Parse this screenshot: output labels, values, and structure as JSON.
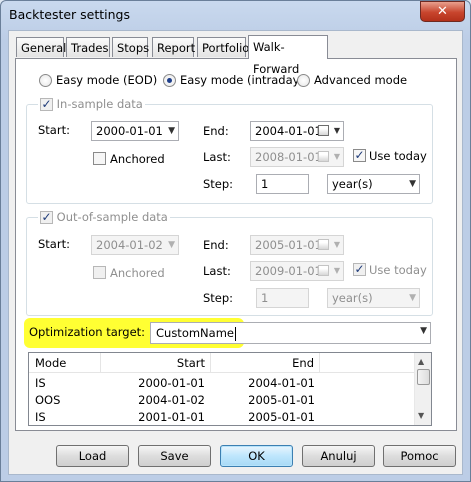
{
  "window": {
    "title": "Backtester settings",
    "close_glyph": "✕"
  },
  "tabs": [
    "General",
    "Trades",
    "Stops",
    "Report",
    "Portfolio",
    "Walk-Forward"
  ],
  "active_tab": "Walk-Forward",
  "modes": [
    {
      "label": "Easy mode (EOD)",
      "selected": false
    },
    {
      "label": "Easy mode (intraday)",
      "selected": true
    },
    {
      "label": "Advanced mode",
      "selected": false
    }
  ],
  "in_sample": {
    "title": "In-sample data",
    "start_label": "Start:",
    "start_value": "2000-01-01",
    "anchored_label": "Anchored",
    "end_label": "End:",
    "end_value": "2004-01-01",
    "last_label": "Last:",
    "last_value": "2008-01-01",
    "use_today_label": "Use today",
    "step_label": "Step:",
    "step_value": "1",
    "step_unit": "year(s)"
  },
  "out_sample": {
    "title": "Out-of-sample data",
    "start_label": "Start:",
    "start_value": "2004-01-02",
    "anchored_label": "Anchored",
    "end_label": "End:",
    "end_value": "2005-01-01",
    "last_label": "Last:",
    "last_value": "2009-01-01",
    "use_today_label": "Use today",
    "step_label": "Step:",
    "step_value": "1",
    "step_unit": "year(s)"
  },
  "optimization": {
    "label": "Optimization target:",
    "value": "CustomName"
  },
  "table": {
    "columns": [
      "Mode",
      "Start",
      "End"
    ],
    "rows": [
      [
        "IS",
        "2000-01-01",
        "2004-01-01"
      ],
      [
        "OOS",
        "2004-01-02",
        "2005-01-01"
      ],
      [
        "IS",
        "2001-01-01",
        "2005-01-01"
      ]
    ]
  },
  "buttons": [
    "Load",
    "Save",
    "OK",
    "Anuluj",
    "Pomoc"
  ],
  "colors": {
    "highlight": "#ffff33",
    "default_button": "#bee6fd",
    "title_bar": "#c9d9ee"
  }
}
